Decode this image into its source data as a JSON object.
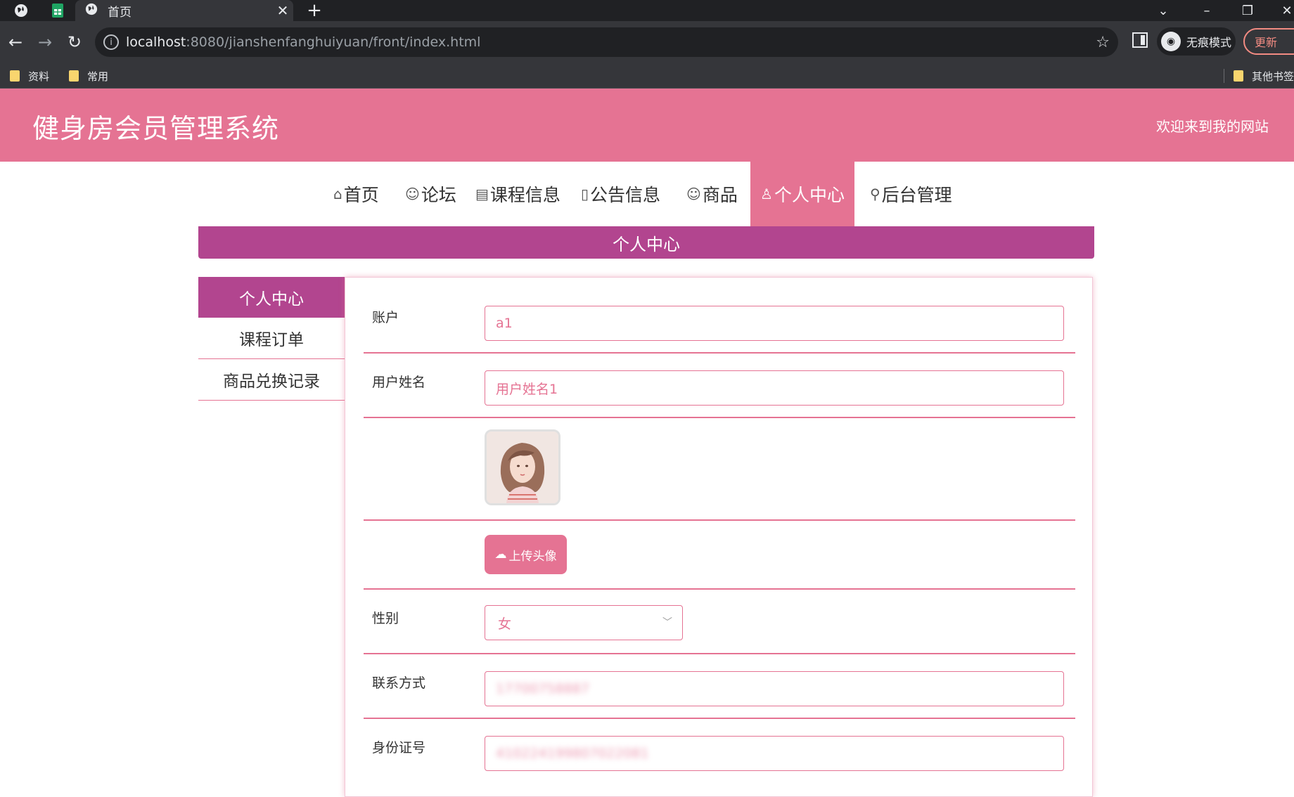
{
  "browser": {
    "tab_title": "首页",
    "url_host": "localhost",
    "url_rest": ":8080/jianshenfanghuiyuan/front/index.html",
    "incognito_label": "无痕模式",
    "update_label": "更新",
    "bookmarks": [
      "资料",
      "常用"
    ],
    "other_bookmarks": "其他书签"
  },
  "site": {
    "title": "健身房会员管理系统",
    "welcome": "欢迎来到我的网站"
  },
  "nav": {
    "items": [
      {
        "icon": "⌂",
        "label": "首页"
      },
      {
        "icon": "☺",
        "label": "论坛"
      },
      {
        "icon": "▤",
        "label": "课程信息"
      },
      {
        "icon": "▯",
        "label": "公告信息"
      },
      {
        "icon": "☺",
        "label": "商品"
      },
      {
        "icon": "♙",
        "label": "个人中心"
      },
      {
        "icon": "⚲",
        "label": "后台管理"
      }
    ],
    "active": "个人中心"
  },
  "section_title": "个人中心",
  "left_menu": [
    "个人中心",
    "课程订单",
    "商品兑换记录"
  ],
  "form": {
    "account_label": "账户",
    "account_value": "a1",
    "name_label": "用户姓名",
    "name_value": "用户姓名1",
    "upload_label": "上传头像",
    "gender_label": "性别",
    "gender_value": "女",
    "phone_label": "联系方式",
    "phone_value": "17700758887",
    "id_label": "身份证号",
    "id_value": "410224199807022081"
  },
  "colors": {
    "header": "#e57393",
    "accent": "#b2458f"
  }
}
